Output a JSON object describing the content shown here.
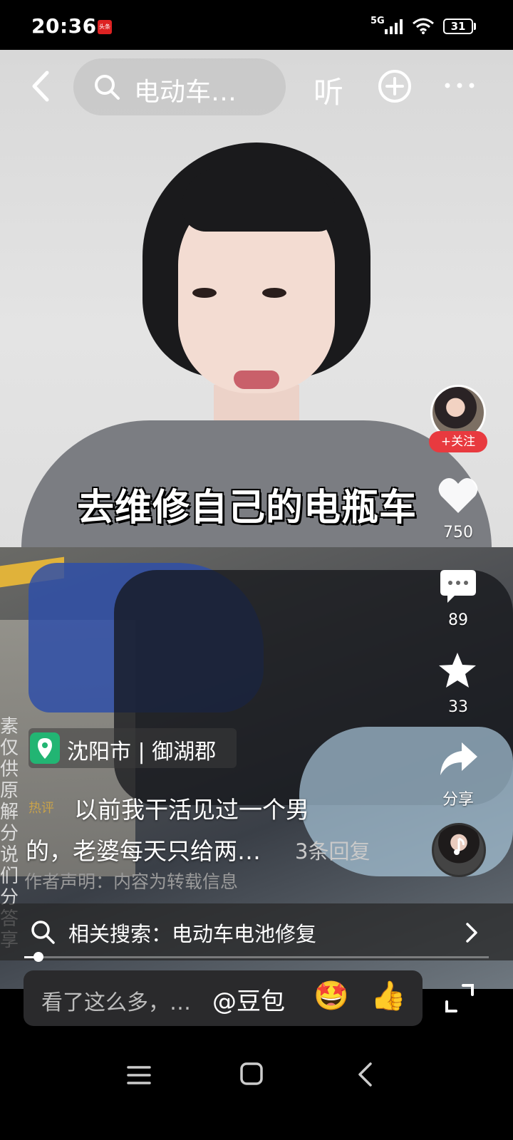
{
  "status_bar": {
    "time": "20:36",
    "app_badge": "头条",
    "network": "5G",
    "battery": "31"
  },
  "top_nav": {
    "search_text": "电动车…",
    "listen_label": "听"
  },
  "video": {
    "caption": "去维修自己的电瓶车"
  },
  "creator": {
    "follow_label": "+关注"
  },
  "actions": {
    "likes": "750",
    "comments": "89",
    "favorites": "33",
    "share_label": "分享"
  },
  "location": {
    "text": "沈阳市 | 御湖郡"
  },
  "side_text": "素仅\n供\n原解\n分说\n们分\n答享",
  "comment": {
    "tag": "热评",
    "line1": "以前我干活见过一个男",
    "line2": "的，老婆每天只给两…",
    "replies": "3条回复"
  },
  "disclaimer": "作者声明：内容为转载信息",
  "related_search": {
    "text": "相关搜索：电动车电池修复"
  },
  "playback": {
    "progress": 0.03
  },
  "input_bar": {
    "placeholder": "看了这么多，…",
    "mention": "@豆包",
    "emoji1": "🤩",
    "emoji2": "👍"
  },
  "colors": {
    "follow_red": "#e83a3f",
    "location_green": "#22b573",
    "tag_gold": "#c8a24a"
  }
}
